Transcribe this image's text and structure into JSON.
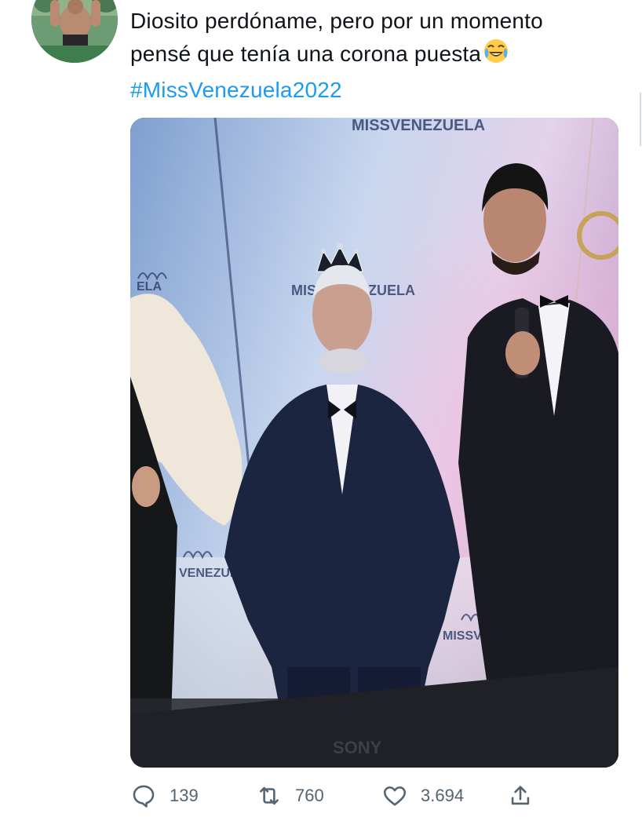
{
  "tweet": {
    "text_line1": "Diosito perdóname, pero por un momento",
    "text_line2": "pensé que tenía una corona puesta",
    "emoji": "face-with-tears-of-joy",
    "hashtag": "#MissVenezuela2022"
  },
  "media": {
    "tv_brand": "SONY",
    "backdrop_logo": "MISSVENEZUELA"
  },
  "actions": {
    "reply_count": "139",
    "retweet_count": "760",
    "like_count": "3.694"
  },
  "icons": {
    "reply": "reply-icon",
    "retweet": "retweet-icon",
    "like": "like-icon",
    "share": "share-icon"
  },
  "colors": {
    "text": "#0f1419",
    "hashtag": "#1d9bf0",
    "action_gray": "#536471"
  }
}
